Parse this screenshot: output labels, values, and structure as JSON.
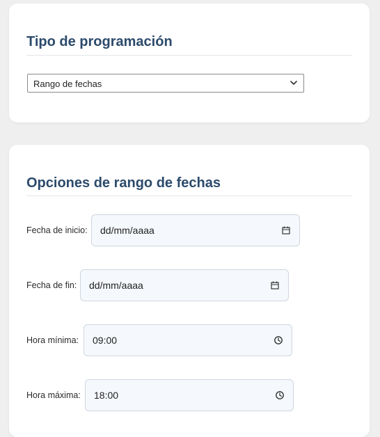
{
  "schedule_type": {
    "title": "Tipo de programación",
    "select": {
      "selected": "Rango de fechas",
      "icon": "chevron-down-icon"
    }
  },
  "date_range": {
    "title": "Opciones de rango de fechas",
    "fields": [
      {
        "label": "Fecha de inicio:",
        "value": "dd/mm/aaaa",
        "icon": "calendar-icon"
      },
      {
        "label": "Fecha de fin:",
        "value": "dd/mm/aaaa",
        "icon": "calendar-icon"
      },
      {
        "label": "Hora mínima:",
        "value": "09:00",
        "icon": "clock-icon"
      },
      {
        "label": "Hora máxima:",
        "value": "18:00",
        "icon": "clock-icon"
      }
    ]
  },
  "colors": {
    "title": "#2c4a6b",
    "background": "#efefef",
    "input_background": "#f5f8fc",
    "input_border": "#cfd6df"
  }
}
